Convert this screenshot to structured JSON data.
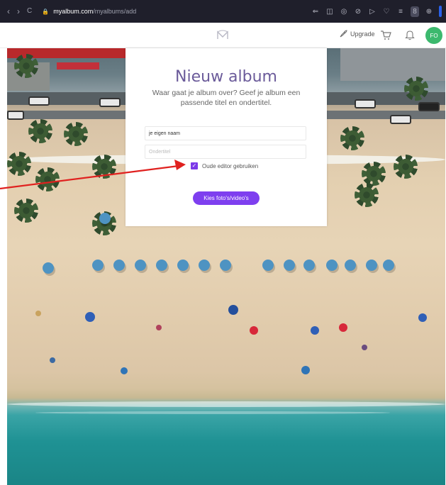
{
  "browser": {
    "url_host": "myalbum.com",
    "url_path": "/myalbums/add",
    "back_glyph": "‹",
    "forward_glyph": "›",
    "reload_glyph": "C",
    "lock_glyph": "🔒",
    "toolbar_glyphs": [
      "⇐",
      "◫",
      "◎",
      "⊘",
      "▷",
      "♡",
      "≡",
      "8",
      "⊕"
    ]
  },
  "header": {
    "logo_icon": "myalbum-logo-icon",
    "upgrade_label": "Upgrade",
    "avatar_initials": "FO",
    "colors": {
      "avatar": "#3cb96e"
    }
  },
  "form": {
    "title": "Nieuw album",
    "subtitle": "Waar gaat je album over? Geef je album een passende titel en ondertitel.",
    "title_value": "je eigen naam",
    "subtitle_placeholder": "Ondertitel",
    "checkbox_label": "Oude editor gebruiken",
    "checkbox_checked": true,
    "button_label": "Kies foto's/video's",
    "colors": {
      "title": "#6b5b9a",
      "accent": "#7e3fef"
    }
  },
  "annotation": {
    "arrow_color": "#e0211f"
  }
}
